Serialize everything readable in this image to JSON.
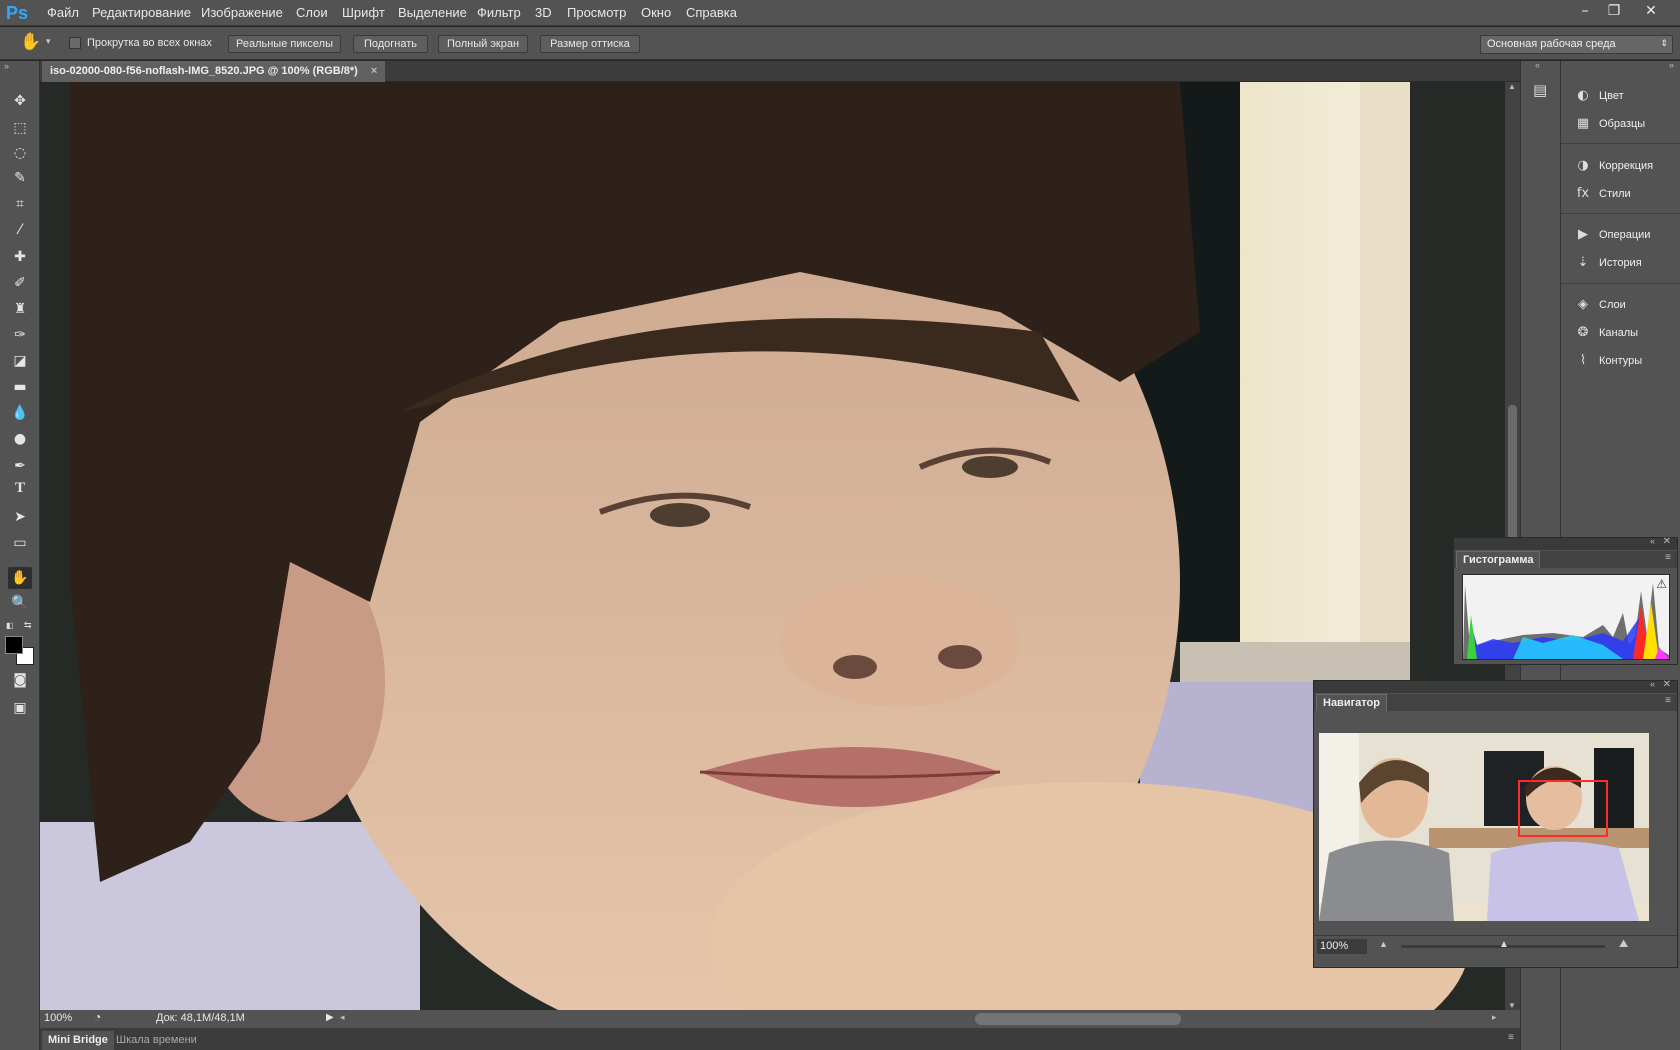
{
  "app": {
    "logo": "Ps"
  },
  "menu": [
    "Файл",
    "Редактирование",
    "Изображение",
    "Слои",
    "Шрифт",
    "Выделение",
    "Фильтр",
    "3D",
    "Просмотр",
    "Окно",
    "Справка"
  ],
  "window_controls": [
    "–",
    "❐",
    "✕"
  ],
  "options": {
    "scroll_all": "Прокрутка во всех окнах",
    "buttons": [
      "Реальные пикселы",
      "Подогнать",
      "Полный экран",
      "Размер оттиска"
    ],
    "workspace": "Основная рабочая среда"
  },
  "document": {
    "tab_title": "iso-02000-080-f56-noflash-IMG_8520.JPG @ 100% (RGB/8*)",
    "close": "×"
  },
  "status": {
    "zoom": "100%",
    "doc_size": "Док: 48,1M/48,1M"
  },
  "bottom_tabs": [
    "Mini Bridge",
    "Шкала времени"
  ],
  "dock": [
    {
      "label": "Цвет",
      "icon": "palette-icon",
      "glyph": "◐"
    },
    {
      "label": "Образцы",
      "icon": "swatches-icon",
      "glyph": "▦"
    },
    {
      "label": "Коррекция",
      "icon": "adjustments-icon",
      "glyph": "◑"
    },
    {
      "label": "Стили",
      "icon": "styles-icon",
      "glyph": "fx"
    },
    {
      "label": "Операции",
      "icon": "actions-icon",
      "glyph": "▶"
    },
    {
      "label": "История",
      "icon": "history-icon",
      "glyph": "⇣"
    },
    {
      "label": "Слои",
      "icon": "layers-icon",
      "glyph": "◈"
    },
    {
      "label": "Каналы",
      "icon": "channels-icon",
      "glyph": "❂"
    },
    {
      "label": "Контуры",
      "icon": "paths-icon",
      "glyph": "⌇"
    }
  ],
  "histogram": {
    "title": "Гистограмма",
    "warning": "⚠"
  },
  "navigator": {
    "title": "Навигатор",
    "zoom": "100%"
  },
  "colors": {
    "accent": "#31a8ff",
    "bg": "#535353",
    "dark": "#282828"
  }
}
